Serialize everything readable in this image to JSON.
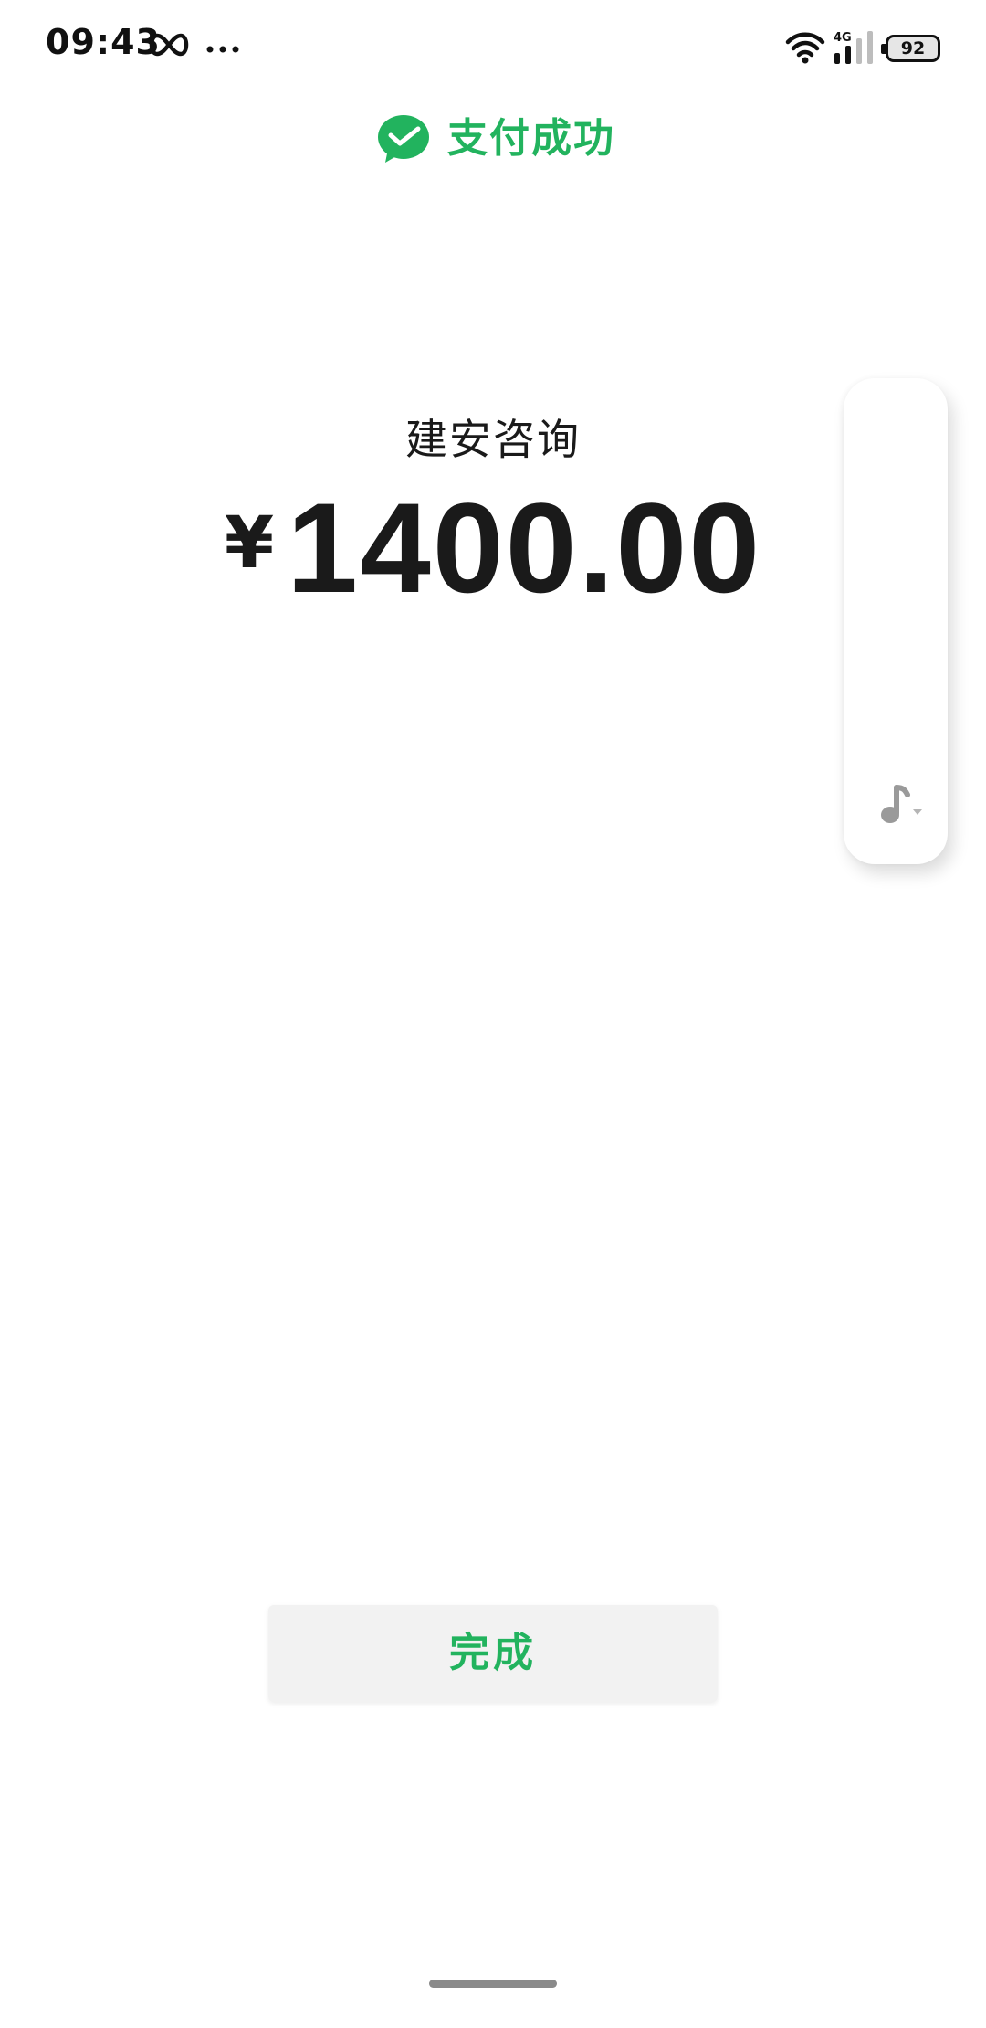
{
  "status_bar": {
    "time": "09:43",
    "network_label": "4G",
    "battery_level": "92"
  },
  "header": {
    "title": "支付成功",
    "accent_color": "#22b35e",
    "logo_icon": "wechat-pay-logo"
  },
  "payment": {
    "merchant": "建安咨询",
    "currency_symbol": "¥",
    "amount": "1400.00"
  },
  "side_panel": {
    "icon": "music-note-icon"
  },
  "actions": {
    "done_label": "完成"
  }
}
